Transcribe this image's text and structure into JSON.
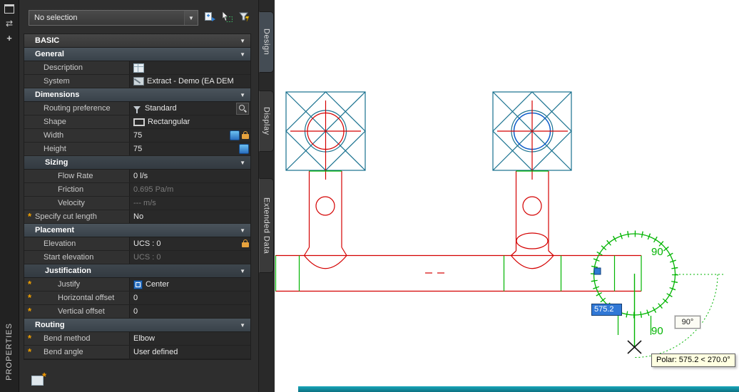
{
  "colors": {
    "canvas_bg": "#ffffff",
    "palette_bg": "#2e2e2e",
    "section_header": "#39424a",
    "duct_red": "#d40000",
    "fitting_green": "#00b400",
    "diffuser_teal": "#17708e",
    "selection_blue": "#0a5ac8",
    "dynamic_input_bg": "#3178d6",
    "tooltip_bg": "#ffffe1",
    "bottom_bar_teal": "#0f8ba0",
    "override_orange": "#f0a000"
  },
  "palette_title": "PROPERTIES",
  "toolbar": {
    "selection": "No selection"
  },
  "tabs": [
    "Design",
    "Display",
    "Extended Data"
  ],
  "sections": {
    "basic": "BASIC",
    "general": "General",
    "dimensions": "Dimensions",
    "sizing": "Sizing",
    "placement": "Placement",
    "justification": "Justification",
    "routing": "Routing"
  },
  "rows": {
    "description": {
      "label": "Description",
      "value": ""
    },
    "system": {
      "label": "System",
      "value": "Extract - Demo (EA DEM"
    },
    "routing_preference": {
      "label": "Routing preference",
      "value": "Standard"
    },
    "shape": {
      "label": "Shape",
      "value": "Rectangular"
    },
    "width": {
      "label": "Width",
      "value": "75"
    },
    "height": {
      "label": "Height",
      "value": "75"
    },
    "flow_rate": {
      "label": "Flow Rate",
      "value": "0 l/s"
    },
    "friction": {
      "label": "Friction",
      "value": "0.695 Pa/m"
    },
    "velocity": {
      "label": "Velocity",
      "value": "--- m/s"
    },
    "specify_cut_length": {
      "label": "Specify cut length",
      "value": "No"
    },
    "elevation": {
      "label": "Elevation",
      "value": "UCS : 0"
    },
    "start_elevation": {
      "label": "Start elevation",
      "value": "UCS : 0"
    },
    "justify": {
      "label": "Justify",
      "value": "Center"
    },
    "horizontal_offset": {
      "label": "Horizontal offset",
      "value": "0"
    },
    "vertical_offset": {
      "label": "Vertical offset",
      "value": "0"
    },
    "bend_method": {
      "label": "Bend method",
      "value": "Elbow"
    },
    "bend_angle": {
      "label": "Bend angle",
      "value": "User defined"
    }
  },
  "drawing": {
    "angle_top": "90",
    "angle_bottom": "90",
    "distance_input": "575.2",
    "angle_readout": "90°",
    "tooltip": "Polar: 575.2 < 270.0°"
  },
  "icons": {
    "chevron": "▼",
    "dropdown_arrow": "▼",
    "override_asterisk": "*",
    "auto_hide": "⇄"
  }
}
